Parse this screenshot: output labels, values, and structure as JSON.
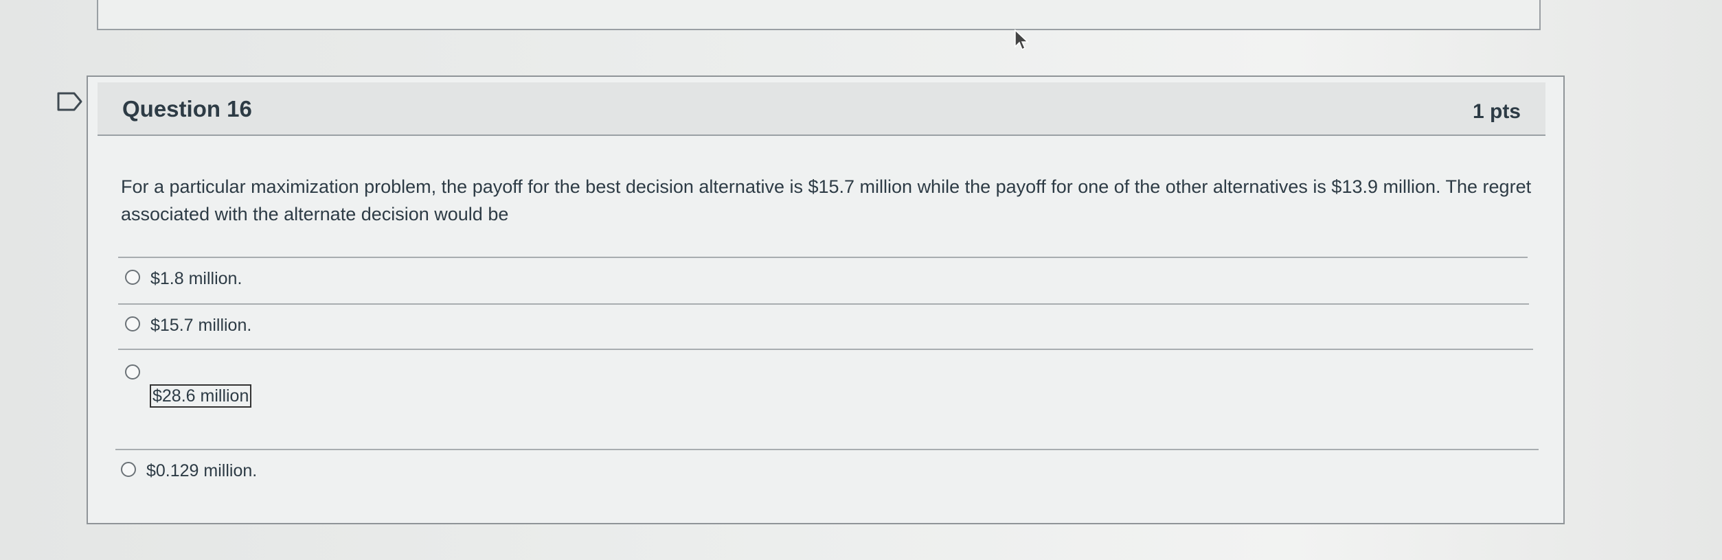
{
  "question": {
    "title": "Question 16",
    "points": "1 pts",
    "text": "For a particular maximization problem, the payoff for the best decision alternative is $15.7 million while the payoff for one of the other alternatives is $13.9 million. The regret associated with the alternate decision would be",
    "answers": [
      {
        "label": "$1.8 million."
      },
      {
        "label": "$15.7 million."
      },
      {
        "label": "$28.6 million"
      },
      {
        "label": "$0.129 million."
      }
    ]
  },
  "icons": {
    "flag": "flag-icon",
    "cursor": "mouse-cursor-icon",
    "radio": "radio-button-icon"
  },
  "colors": {
    "text": "#2d3b45",
    "header_bg": "#e2e4e4",
    "border": "#8f9498"
  }
}
